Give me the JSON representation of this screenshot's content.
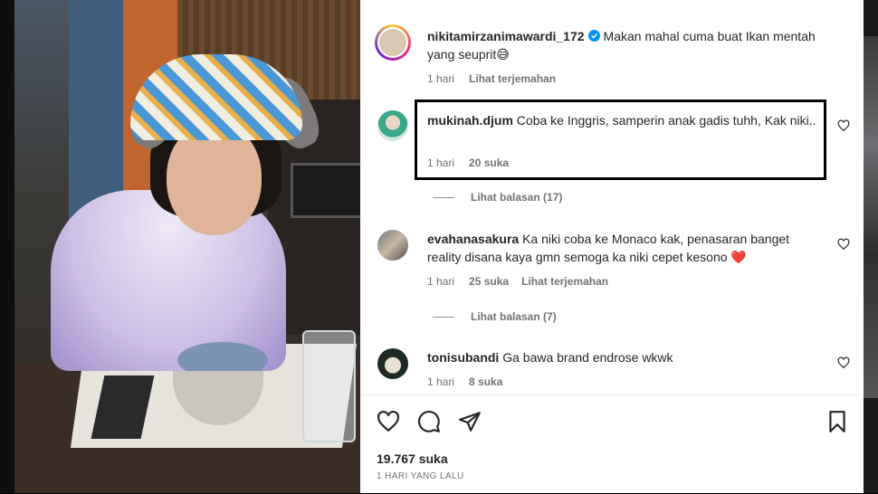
{
  "post": {
    "author": "nikitamirzanimawardi_172",
    "caption": "Makan mahal cuma buat Ikan mentah yang seuprit😅",
    "caption_age": "1 hari",
    "translate_label": "Lihat terjemahan"
  },
  "comments": [
    {
      "username": "mukinah.djum",
      "text": "Coba ke Inggris, samperin anak gadis tuhh, Kak niki..",
      "age": "1 hari",
      "likes": "20 suka",
      "view_replies": "Lihat balasan (17)"
    },
    {
      "username": "evahanasakura",
      "text": "Ka niki coba ke Monaco kak, penasaran banget reality disana kaya gmn semoga ka niki cepet kesono ❤️",
      "age": "1 hari",
      "likes": "25 suka",
      "translate_label": "Lihat terjemahan",
      "view_replies": "Lihat balasan (7)"
    },
    {
      "username": "tonisubandi",
      "text": "Ga bawa brand endrose wkwk",
      "age": "1 hari",
      "likes": "8 suka"
    }
  ],
  "footer": {
    "likes_count": "19.767 suka",
    "posted_ago": "1 HARI YANG LALU"
  },
  "icons": {
    "like": "heart-icon",
    "comment": "comment-bubble-icon",
    "share": "paper-plane-icon",
    "save": "bookmark-icon",
    "verified": "verified-badge-icon"
  },
  "colors": {
    "verified": "#0095f6",
    "text": "#262626",
    "muted": "#737373",
    "highlight_border": "#000000"
  }
}
